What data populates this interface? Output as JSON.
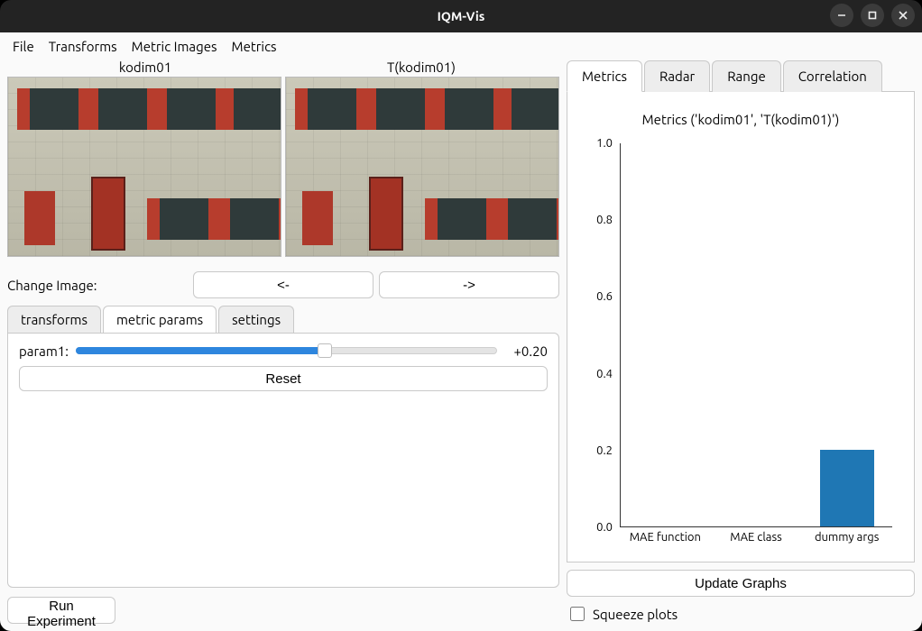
{
  "window_title": "IQM-Vis",
  "menubar": [
    "File",
    "Transforms",
    "Metric Images",
    "Metrics"
  ],
  "images": {
    "left_label": "kodim01",
    "right_label": "T(kodim01)"
  },
  "change_image": {
    "label": "Change Image:",
    "prev": "<-",
    "next": "->"
  },
  "param_tabs": {
    "items": [
      "transforms",
      "metric params",
      "settings"
    ],
    "active": 1
  },
  "param_panel": {
    "slider_label": "param1:",
    "slider_value_text": "+0.20",
    "slider_fraction": 0.59,
    "reset_label": "Reset"
  },
  "run_experiment_label": "Run Experiment",
  "metric_tabs": {
    "items": [
      "Metrics",
      "Radar",
      "Range",
      "Correlation"
    ],
    "active": 0
  },
  "chart_title": "Metrics ('kodim01', 'T(kodim01)')",
  "chart_data": {
    "type": "bar",
    "categories": [
      "MAE function",
      "MAE class",
      "dummy args"
    ],
    "values": [
      0.0,
      0.0,
      0.2
    ],
    "ylim": [
      0.0,
      1.0
    ],
    "yticks": [
      0.0,
      0.2,
      0.4,
      0.6,
      0.8,
      1.0
    ],
    "title": "Metrics ('kodim01', 'T(kodim01)')"
  },
  "update_graphs_label": "Update Graphs",
  "squeeze_label": "Squeeze plots",
  "squeeze_checked": false
}
